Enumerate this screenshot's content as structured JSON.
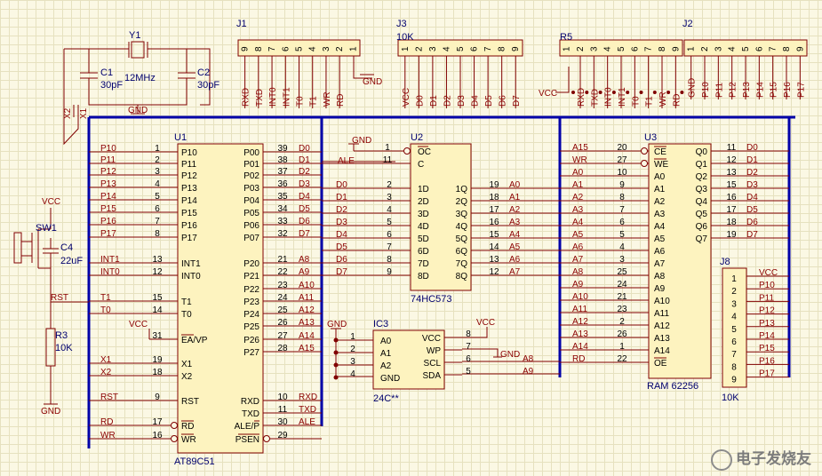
{
  "watermark": {
    "text": "电子发烧友",
    "url": "www.elecfans.com"
  },
  "labels": {
    "j1": "J1",
    "j3": "J3",
    "j3_val": "10K",
    "r5": "R5",
    "j2": "J2",
    "y1": "Y1",
    "y1_val": "12MHz",
    "c1": "C1",
    "c1_val": "30pF",
    "c2": "C2",
    "c2_val": "30pF",
    "gnd": "GND",
    "vcc": "VCC",
    "x1": "X1",
    "x2": "X2",
    "sw1": "SW1",
    "c4": "C4",
    "c4_val": "22uF",
    "rst": "RST",
    "r3": "R3",
    "r3_val": "10K",
    "u1": "U1",
    "u1_part": "AT89C51",
    "u2": "U2",
    "u2_part": "74HC573",
    "u3": "U3",
    "u3_part": "RAM 62256",
    "ic3": "IC3",
    "ic3_part": "24C**",
    "j8": "J8",
    "j8_val": "10K",
    "ale": "ALE"
  },
  "j1_pins": [
    "9",
    "8",
    "7",
    "6",
    "5",
    "4",
    "3",
    "2",
    "1"
  ],
  "j1_nets": [
    "RXD",
    "TXD",
    "INT0",
    "INT1",
    "T0",
    "T1",
    "WR",
    "RD"
  ],
  "j3_pins": [
    "1",
    "2",
    "3",
    "4",
    "5",
    "6",
    "7",
    "8",
    "9"
  ],
  "j3_nets": [
    "VCC",
    "D0",
    "D1",
    "D2",
    "D3",
    "D4",
    "D5",
    "D6",
    "D7"
  ],
  "r5_pins": [
    "1",
    "2",
    "3",
    "4",
    "5",
    "6",
    "7",
    "8",
    "9"
  ],
  "r5_nets": [
    "RXD",
    "TXD",
    "INT0",
    "INT1",
    "T0",
    "T1",
    "WR",
    "RD"
  ],
  "j2_pins": [
    "1",
    "2",
    "3",
    "4",
    "5",
    "6",
    "7",
    "8",
    "9"
  ],
  "j2_nets": [
    "GND",
    "P10",
    "P11",
    "P12",
    "P13",
    "P14",
    "P15",
    "P16",
    "P17"
  ],
  "u1_left": [
    {
      "net": "P10",
      "num": "1",
      "pin": "P10"
    },
    {
      "net": "P11",
      "num": "2",
      "pin": "P11"
    },
    {
      "net": "P12",
      "num": "3",
      "pin": "P12"
    },
    {
      "net": "P13",
      "num": "4",
      "pin": "P13"
    },
    {
      "net": "P14",
      "num": "5",
      "pin": "P14"
    },
    {
      "net": "P15",
      "num": "6",
      "pin": "P15"
    },
    {
      "net": "P16",
      "num": "7",
      "pin": "P16"
    },
    {
      "net": "P17",
      "num": "8",
      "pin": "P17"
    },
    {
      "net": "INT1",
      "num": "13",
      "pin": "INT1"
    },
    {
      "net": "INT0",
      "num": "12",
      "pin": "INT0"
    },
    {
      "net": "T1",
      "num": "15",
      "pin": "T1"
    },
    {
      "net": "T0",
      "num": "14",
      "pin": "T0"
    },
    {
      "net": "VCC",
      "num": "31",
      "pin": "EA/VP"
    },
    {
      "net": "X1",
      "num": "19",
      "pin": "X1"
    },
    {
      "net": "X2",
      "num": "18",
      "pin": "X2"
    },
    {
      "net": "RST",
      "num": "9",
      "pin": "RST"
    },
    {
      "net": "RD",
      "num": "17",
      "pin": "RD"
    },
    {
      "net": "WR",
      "num": "16",
      "pin": "WR"
    }
  ],
  "u1_right": [
    {
      "pin": "P00",
      "num": "39",
      "net": "D0"
    },
    {
      "pin": "P01",
      "num": "38",
      "net": "D1"
    },
    {
      "pin": "P02",
      "num": "37",
      "net": "D2"
    },
    {
      "pin": "P03",
      "num": "36",
      "net": "D3"
    },
    {
      "pin": "P04",
      "num": "35",
      "net": "D4"
    },
    {
      "pin": "P05",
      "num": "34",
      "net": "D5"
    },
    {
      "pin": "P06",
      "num": "33",
      "net": "D6"
    },
    {
      "pin": "P07",
      "num": "32",
      "net": "D7"
    },
    {
      "pin": "P20",
      "num": "21",
      "net": "A8"
    },
    {
      "pin": "P21",
      "num": "22",
      "net": "A9"
    },
    {
      "pin": "P22",
      "num": "23",
      "net": "A10"
    },
    {
      "pin": "P23",
      "num": "24",
      "net": "A11"
    },
    {
      "pin": "P24",
      "num": "25",
      "net": "A12"
    },
    {
      "pin": "P25",
      "num": "26",
      "net": "A13"
    },
    {
      "pin": "P26",
      "num": "27",
      "net": "A14"
    },
    {
      "pin": "P27",
      "num": "28",
      "net": "A15"
    },
    {
      "pin": "RXD",
      "num": "10",
      "net": "RXD"
    },
    {
      "pin": "TXD",
      "num": "11",
      "net": "TXD"
    },
    {
      "pin": "ALE/P",
      "num": "30",
      "net": "ALE"
    },
    {
      "pin": "PSEN",
      "num": "29",
      "net": ""
    }
  ],
  "u2_top": [
    {
      "net": "GND",
      "num": "1",
      "pin": "OC"
    },
    {
      "net": "ALE",
      "num": "11",
      "pin": "C"
    }
  ],
  "u2_left": [
    {
      "net": "D0",
      "num": "2",
      "pin": "1D"
    },
    {
      "net": "D1",
      "num": "3",
      "pin": "2D"
    },
    {
      "net": "D2",
      "num": "4",
      "pin": "3D"
    },
    {
      "net": "D3",
      "num": "5",
      "pin": "4D"
    },
    {
      "net": "D4",
      "num": "6",
      "pin": "5D"
    },
    {
      "net": "D5",
      "num": "7",
      "pin": "6D"
    },
    {
      "net": "D6",
      "num": "8",
      "pin": "7D"
    },
    {
      "net": "D7",
      "num": "9",
      "pin": "8D"
    }
  ],
  "u2_right": [
    {
      "pin": "1Q",
      "num": "19",
      "net": "A0"
    },
    {
      "pin": "2Q",
      "num": "18",
      "net": "A1"
    },
    {
      "pin": "3Q",
      "num": "17",
      "net": "A2"
    },
    {
      "pin": "4Q",
      "num": "16",
      "net": "A3"
    },
    {
      "pin": "5Q",
      "num": "15",
      "net": "A4"
    },
    {
      "pin": "6Q",
      "num": "14",
      "net": "A5"
    },
    {
      "pin": "7Q",
      "num": "13",
      "net": "A6"
    },
    {
      "pin": "8Q",
      "num": "12",
      "net": "A7"
    }
  ],
  "u3_left": [
    {
      "net": "A15",
      "num": "20",
      "pin": "CE"
    },
    {
      "net": "WR",
      "num": "27",
      "pin": "WE"
    },
    {
      "net": "A0",
      "num": "10",
      "pin": "A0"
    },
    {
      "net": "A1",
      "num": "9",
      "pin": "A1"
    },
    {
      "net": "A2",
      "num": "8",
      "pin": "A2"
    },
    {
      "net": "A3",
      "num": "7",
      "pin": "A3"
    },
    {
      "net": "A4",
      "num": "6",
      "pin": "A4"
    },
    {
      "net": "A5",
      "num": "5",
      "pin": "A5"
    },
    {
      "net": "A6",
      "num": "4",
      "pin": "A6"
    },
    {
      "net": "A7",
      "num": "3",
      "pin": "A7"
    },
    {
      "net": "A8",
      "num": "25",
      "pin": "A8"
    },
    {
      "net": "A9",
      "num": "24",
      "pin": "A9"
    },
    {
      "net": "A10",
      "num": "21",
      "pin": "A10"
    },
    {
      "net": "A11",
      "num": "23",
      "pin": "A11"
    },
    {
      "net": "A12",
      "num": "2",
      "pin": "A12"
    },
    {
      "net": "A13",
      "num": "26",
      "pin": "A13"
    },
    {
      "net": "A14",
      "num": "1",
      "pin": "A14"
    },
    {
      "net": "RD",
      "num": "22",
      "pin": "OE"
    }
  ],
  "u3_right": [
    {
      "pin": "Q0",
      "num": "11",
      "net": "D0"
    },
    {
      "pin": "Q1",
      "num": "12",
      "net": "D1"
    },
    {
      "pin": "Q2",
      "num": "13",
      "net": "D2"
    },
    {
      "pin": "Q3",
      "num": "15",
      "net": "D3"
    },
    {
      "pin": "Q4",
      "num": "16",
      "net": "D4"
    },
    {
      "pin": "Q5",
      "num": "17",
      "net": "D5"
    },
    {
      "pin": "Q6",
      "num": "18",
      "net": "D6"
    },
    {
      "pin": "Q7",
      "num": "19",
      "net": "D7"
    }
  ],
  "ic3_left": [
    {
      "num": "1",
      "pin": "A0"
    },
    {
      "num": "2",
      "pin": "A1"
    },
    {
      "num": "3",
      "pin": "A2"
    },
    {
      "num": "4",
      "pin": "GND"
    }
  ],
  "ic3_right": [
    {
      "pin": "VCC",
      "num": "8",
      "net": "VCC"
    },
    {
      "pin": "WP",
      "num": "7",
      "net": "GND"
    },
    {
      "pin": "SCL",
      "num": "6",
      "net": "A8"
    },
    {
      "pin": "SDA",
      "num": "5",
      "net": "A9"
    }
  ],
  "j8_pins": [
    "1",
    "2",
    "3",
    "4",
    "5",
    "6",
    "7",
    "8",
    "9"
  ],
  "j8_nets": [
    "VCC",
    "P10",
    "P11",
    "P12",
    "P13",
    "P14",
    "P15",
    "P16",
    "P17"
  ]
}
